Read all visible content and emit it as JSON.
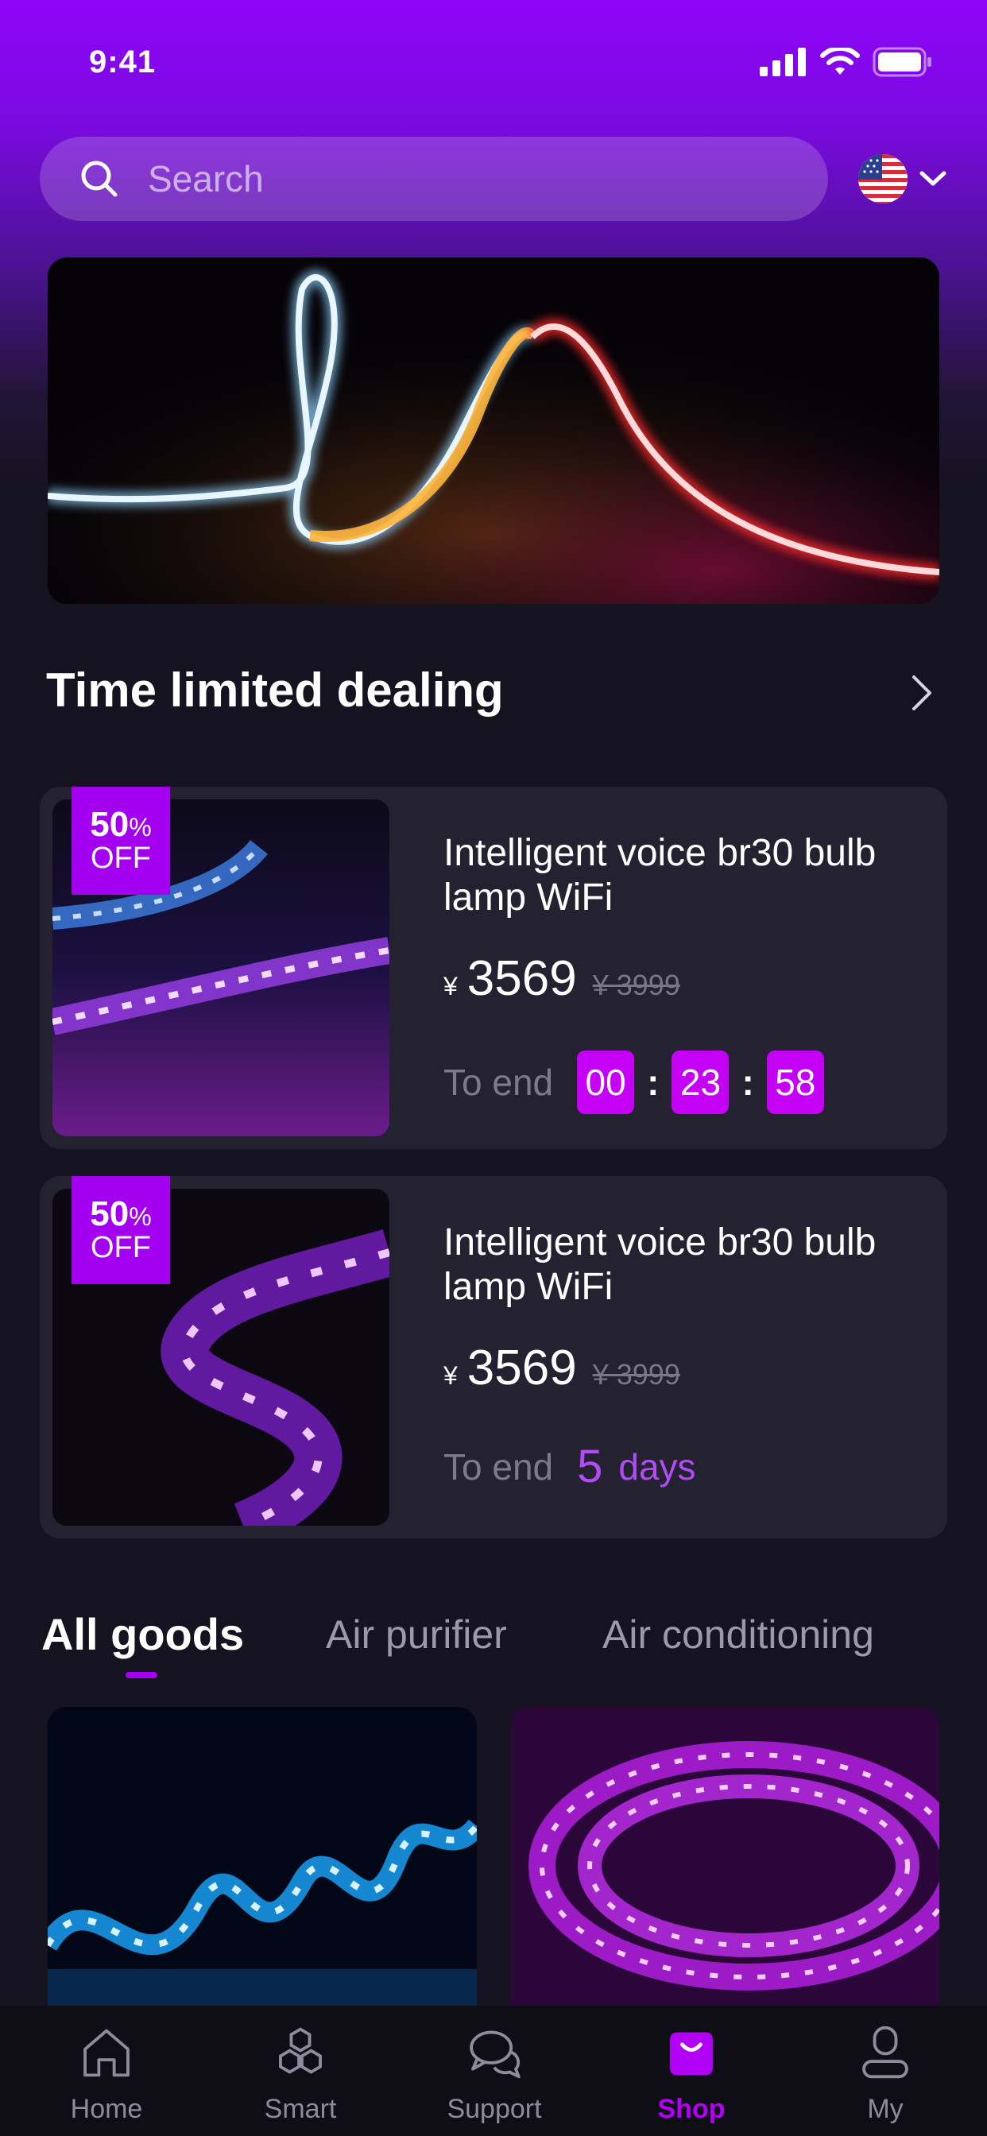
{
  "status_bar": {
    "time": "9:41"
  },
  "search": {
    "placeholder": "Search"
  },
  "deals": {
    "title": "Time limited dealing",
    "items": [
      {
        "badge_pct": "50",
        "badge_pct_sign": "%",
        "badge_off": "OFF",
        "title": "Intelligent voice br30 bulb lamp WiFi",
        "currency": "¥",
        "price": "3569",
        "old_price": "¥ 3999",
        "to_end_label": "To end",
        "timer": {
          "h": "00",
          "m": "23",
          "s": "58"
        }
      },
      {
        "badge_pct": "50",
        "badge_pct_sign": "%",
        "badge_off": "OFF",
        "title": "Intelligent voice br30 bulb lamp WiFi",
        "currency": "¥",
        "price": "3569",
        "old_price": "¥ 3999",
        "to_end_label": "To end",
        "days_num": "5",
        "days_label": "days"
      }
    ]
  },
  "tabs": [
    {
      "label": "All goods",
      "active": true
    },
    {
      "label": "Air purifier",
      "active": false
    },
    {
      "label": "Air conditioning",
      "active": false
    }
  ],
  "nav": [
    {
      "label": "Home",
      "icon": "home-icon"
    },
    {
      "label": "Smart",
      "icon": "smart-icon"
    },
    {
      "label": "Support",
      "icon": "support-icon"
    },
    {
      "label": "Shop",
      "icon": "shop-icon",
      "active": true
    },
    {
      "label": "My",
      "icon": "user-icon"
    }
  ],
  "colors": {
    "accent": "#a300ef",
    "background": "#15131f",
    "card": "#242130"
  }
}
